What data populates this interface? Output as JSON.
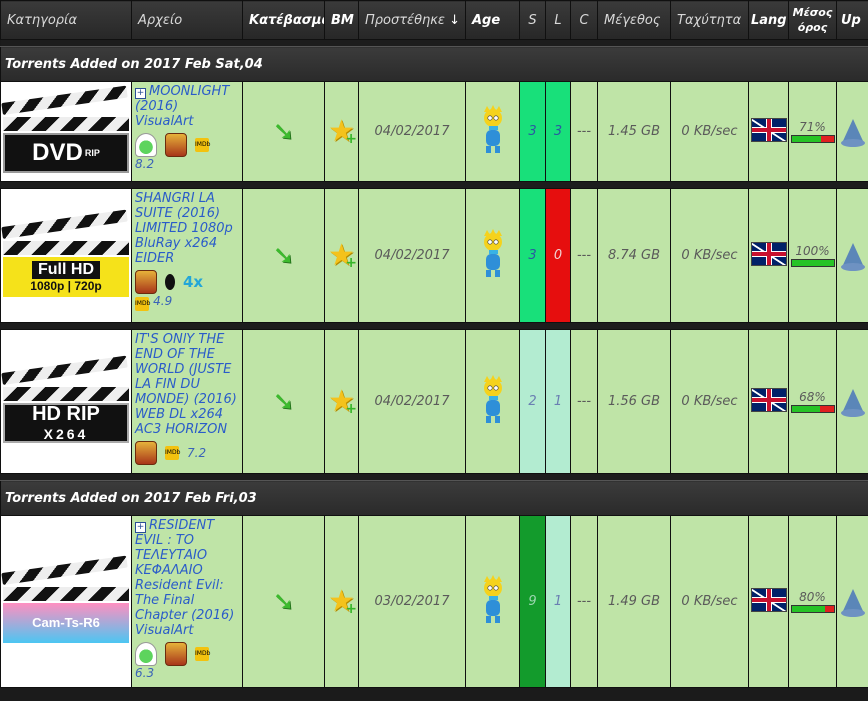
{
  "header": {
    "category": "Κατηγορία",
    "file": "Αρχείο",
    "download": "Κατέβασμα",
    "bm": "BM",
    "added": "Προστέθηκε",
    "sort_arrow": "↓",
    "age": "Age",
    "s": "S",
    "l": "L",
    "c": "C",
    "size": "Μέγεθος",
    "speed": "Ταχύτητα",
    "lang": "Lang",
    "avg": "Μέσος όρος",
    "up": "Up"
  },
  "groups": [
    {
      "label": "Torrents Added on 2017 Feb Sat,04"
    },
    {
      "label": "Torrents Added on 2017 Feb Fri,03"
    }
  ],
  "rows": [
    {
      "cat_line1": "DVD",
      "cat_line2": "RIP",
      "title": "MOONLIGHT (2016) VisualArt",
      "rating": "8.2",
      "date": "04/02/2017",
      "s": "3",
      "l": "3",
      "c": "---",
      "size": "1.45 GB",
      "speed": "0 KB/sec",
      "avg": "71%",
      "avg_value": 71
    },
    {
      "cat_line1": "Full HD",
      "cat_line2": "1080p | 720p",
      "title": "SHANGRI LA SUITE (2016) LIMITED 1080p BluRay x264 EIDER",
      "extra": "4x",
      "rating": "4.9",
      "date": "04/02/2017",
      "s": "3",
      "l": "0",
      "c": "---",
      "size": "8.74 GB",
      "speed": "0 KB/sec",
      "avg": "100%",
      "avg_value": 100
    },
    {
      "cat_line1": "HD RIP",
      "cat_line2": "X264",
      "title": "IT'S ONlY THE END OF THE WORLD (JUSTE LA FIN DU MONDE) (2016) WEB DL x264 AC3 HORIZON",
      "rating": "7.2",
      "date": "04/02/2017",
      "s": "2",
      "l": "1",
      "c": "---",
      "size": "1.56 GB",
      "speed": "0 KB/sec",
      "avg": "68%",
      "avg_value": 68
    },
    {
      "cat_line1": "Cam-Ts-R6",
      "title": "RESIDENT EVIL : ΤΟ ΤΕΛΕΥΤΑΙΟ ΚΕΦΑΛΑΙΟ Resident Evil: The Final Chapter (2016) VisualArt",
      "rating": "6.3",
      "date": "03/02/2017",
      "s": "9",
      "l": "1",
      "c": "---",
      "size": "1.49 GB",
      "speed": "0 KB/sec",
      "avg": "80%",
      "avg_value": 80
    }
  ],
  "icons": {
    "download": "download-arrow-icon",
    "bookmark": "star-bookmark-icon",
    "age": "maggie-simpson-icon",
    "lang": "uk-flag-icon",
    "up": "upload-cone-icon"
  }
}
